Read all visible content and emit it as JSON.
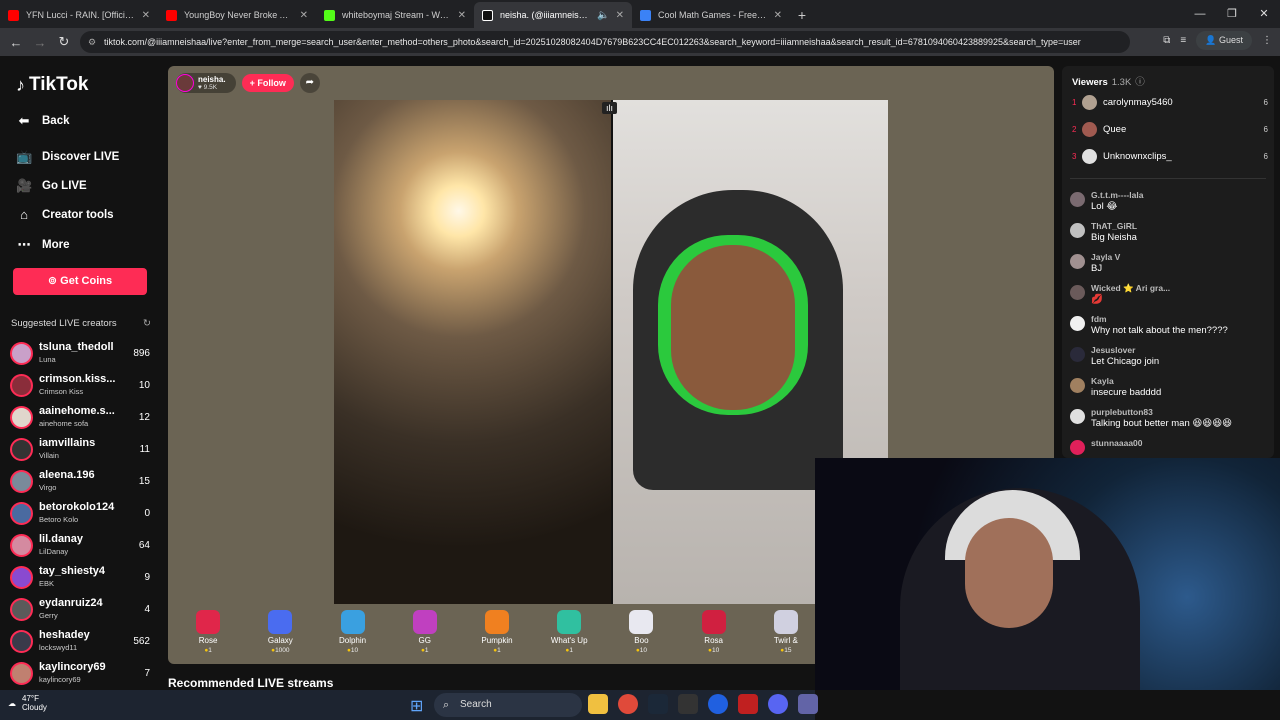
{
  "browser": {
    "tabs": [
      {
        "title": "YFN Lucci - RAIN. [Official Musi",
        "color": "#ff0000"
      },
      {
        "title": "YoungBoy Never Broke Again -",
        "color": "#ff0000"
      },
      {
        "title": "whiteboymaj Stream - Watch Li",
        "color": "#53fc18"
      },
      {
        "title": "neisha. (@iiiamneishaa) is L",
        "color": "#ffffff"
      },
      {
        "title": "Cool Math Games - Free Onlin",
        "color": "#3b82f6"
      }
    ],
    "url": "tiktok.com/@iiiamneishaa/live?enter_from_merge=search_user&enter_method=others_photo&search_id=20251028082404D7679B623CC4EC012263&search_keyword=iiiamneishaa&search_result_id=6781094060423889925&search_type=user",
    "guest_label": "Guest"
  },
  "sidebar": {
    "logo": "TikTok",
    "back": "Back",
    "nav": [
      "Discover LIVE",
      "Go LIVE",
      "Creator tools",
      "More"
    ],
    "coins": "Get Coins",
    "suggested_heading": "Suggested LIVE creators",
    "creators": [
      {
        "name": "tsluna_thedoll",
        "sub": "Luna",
        "count": "896",
        "color": "#c9a0c9"
      },
      {
        "name": "crimson.kiss...",
        "sub": "Crimson Kiss",
        "count": "10",
        "color": "#8a2d3a"
      },
      {
        "name": "aainehome.s...",
        "sub": "ainehome sofa",
        "count": "12",
        "color": "#e0d6cc"
      },
      {
        "name": "iamvillains",
        "sub": "Villain",
        "count": "11",
        "color": "#333333"
      },
      {
        "name": "aleena.196",
        "sub": "Virgo",
        "count": "15",
        "color": "#7a8a9a"
      },
      {
        "name": "betorokolo124",
        "sub": "Betoro Kolo",
        "count": "0",
        "color": "#4a6aa0"
      },
      {
        "name": "lil.danay",
        "sub": "LilDanay",
        "count": "64",
        "color": "#d48aa0"
      },
      {
        "name": "tay_shiesty4",
        "sub": "EBK",
        "count": "9",
        "color": "#8a4ad0"
      },
      {
        "name": "eydanruiz24",
        "sub": "Gerry",
        "count": "4",
        "color": "#5a5a5a"
      },
      {
        "name": "heshadey",
        "sub": "lockswyd11",
        "count": "562",
        "color": "#3a3a4a"
      },
      {
        "name": "kaylincory69",
        "sub": "kaylincory69",
        "count": "7",
        "color": "#c08070"
      }
    ]
  },
  "host": {
    "name": "neisha.",
    "likes": "9.5K",
    "follow": "+ Follow"
  },
  "gifts": [
    {
      "label": "Rose",
      "price": "1",
      "color": "#e0264a"
    },
    {
      "label": "Galaxy",
      "price": "1000",
      "color": "#4a6cf0"
    },
    {
      "label": "Dolphin",
      "price": "10",
      "color": "#3aa0e0"
    },
    {
      "label": "GG",
      "price": "1",
      "color": "#c040c0"
    },
    {
      "label": "Pumpkin",
      "price": "1",
      "color": "#f08020"
    },
    {
      "label": "What's Up",
      "price": "1",
      "color": "#30c0a0"
    },
    {
      "label": "Boo",
      "price": "10",
      "color": "#e8e8f0"
    },
    {
      "label": "Rosa",
      "price": "10",
      "color": "#d02040"
    },
    {
      "label": "Twirl &",
      "price": "15",
      "color": "#d0d0e0"
    }
  ],
  "recommended": "Recommended LIVE streams",
  "viewers": {
    "heading": "Viewers",
    "count": "1.3K",
    "top": [
      {
        "rank": "1",
        "name": "carolynmay5460",
        "score": "6",
        "color": "#b0a090"
      },
      {
        "rank": "2",
        "name": "Quee",
        "score": "6",
        "color": "#a05a50"
      },
      {
        "rank": "3",
        "name": "Unknownxclips_",
        "score": "6",
        "color": "#e0e0e0"
      }
    ]
  },
  "chat": [
    {
      "user": "G.t.t.m----lala",
      "text": "Lol 😂",
      "color": "#7a6a70"
    },
    {
      "user": "ThAT_GiRL",
      "text": "Big Neisha",
      "color": "#c0c0c0"
    },
    {
      "user": "Jayla V",
      "text": "BJ",
      "color": "#a09090"
    },
    {
      "user": "Wicked ⭐ Ari gra...",
      "text": "💋",
      "color": "#6a5a5a"
    },
    {
      "user": "fdm",
      "text": "Why not talk about the men????",
      "color": "#f0f0f0"
    },
    {
      "user": "Jesuslover",
      "text": "Let Chicago join",
      "color": "#2a2a3a"
    },
    {
      "user": "Kayla",
      "text": "insecure badddd",
      "color": "#a08060"
    },
    {
      "user": "purplebutton83",
      "text": "Talking bout better man 😆😆😆😆",
      "color": "#e0e0e0"
    },
    {
      "user": "stunnaaaa00",
      "text": "",
      "color": "#e0205a"
    }
  ],
  "taskbar": {
    "temp": "47°F",
    "weather": "Cloudy",
    "search": "Search"
  }
}
